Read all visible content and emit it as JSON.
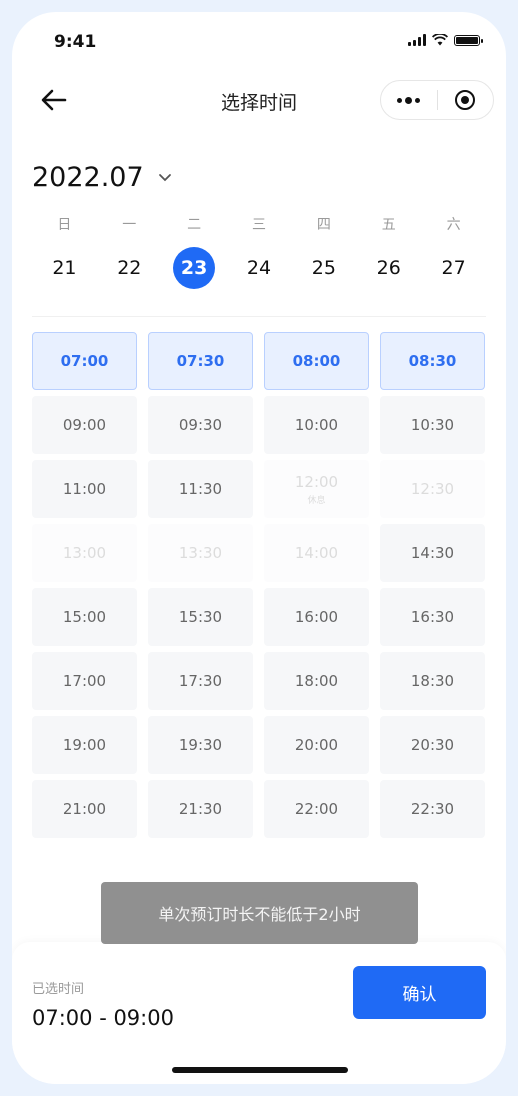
{
  "status_bar": {
    "time": "9:41"
  },
  "nav": {
    "title": "选择时间"
  },
  "month": {
    "label": "2022.07"
  },
  "week": {
    "weekdays": [
      "日",
      "一",
      "二",
      "三",
      "四",
      "五",
      "六"
    ],
    "days": [
      "21",
      "22",
      "23",
      "24",
      "25",
      "26",
      "27"
    ],
    "selected_day": "23"
  },
  "slots": [
    {
      "time": "07:00",
      "state": "selected"
    },
    {
      "time": "07:30",
      "state": "selected"
    },
    {
      "time": "08:00",
      "state": "selected"
    },
    {
      "time": "08:30",
      "state": "selected"
    },
    {
      "time": "09:00",
      "state": "available"
    },
    {
      "time": "09:30",
      "state": "available"
    },
    {
      "time": "10:00",
      "state": "available"
    },
    {
      "time": "10:30",
      "state": "available"
    },
    {
      "time": "11:00",
      "state": "available"
    },
    {
      "time": "11:30",
      "state": "available"
    },
    {
      "time": "12:00",
      "state": "disabled",
      "note": "休息"
    },
    {
      "time": "12:30",
      "state": "disabled"
    },
    {
      "time": "13:00",
      "state": "disabled"
    },
    {
      "time": "13:30",
      "state": "disabled"
    },
    {
      "time": "14:00",
      "state": "disabled"
    },
    {
      "time": "14:30",
      "state": "available"
    },
    {
      "time": "15:00",
      "state": "available"
    },
    {
      "time": "15:30",
      "state": "available"
    },
    {
      "time": "16:00",
      "state": "available"
    },
    {
      "time": "16:30",
      "state": "available"
    },
    {
      "time": "17:00",
      "state": "available"
    },
    {
      "time": "17:30",
      "state": "available"
    },
    {
      "time": "18:00",
      "state": "available"
    },
    {
      "time": "18:30",
      "state": "available"
    },
    {
      "time": "19:00",
      "state": "available"
    },
    {
      "time": "19:30",
      "state": "available"
    },
    {
      "time": "20:00",
      "state": "available"
    },
    {
      "time": "20:30",
      "state": "available"
    },
    {
      "time": "21:00",
      "state": "available"
    },
    {
      "time": "21:30",
      "state": "available"
    },
    {
      "time": "22:00",
      "state": "available"
    },
    {
      "time": "22:30",
      "state": "available"
    }
  ],
  "toast": {
    "message": "单次预订时长不能低于2小时"
  },
  "footer": {
    "selected_label": "已选时间",
    "selected_value": "07:00 - 09:00",
    "confirm_label": "确认"
  },
  "colors": {
    "accent": "#1f6af5",
    "selected_slot_bg": "#e8f0ff",
    "selected_slot_text": "#2e6ef0",
    "slot_bg": "#f6f7f9"
  },
  "icons": {
    "back": "arrow-left-icon",
    "more": "more-dots-icon",
    "close": "target-circle-icon",
    "month_dropdown": "chevron-down-icon"
  }
}
